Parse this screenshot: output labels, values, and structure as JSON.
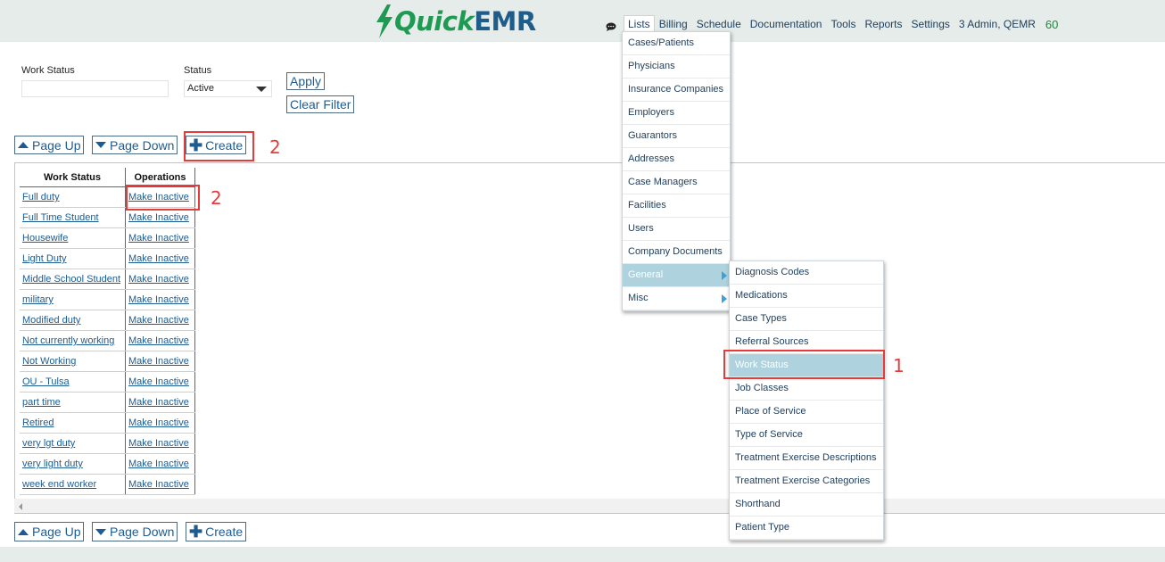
{
  "brand": {
    "part1": "Quick",
    "part2": "EMR"
  },
  "nav": {
    "chat_icon": "speech-bubble-icon",
    "items": [
      "Lists",
      "Billing",
      "Schedule",
      "Documentation",
      "Tools",
      "Reports",
      "Settings",
      "3 Admin, QEMR"
    ],
    "count": "60"
  },
  "filters": {
    "work_status_label": "Work Status",
    "work_status_value": "",
    "status_label": "Status",
    "status_value": "Active",
    "apply": "Apply",
    "clear": "Clear Filter"
  },
  "pager": {
    "page_up": "Page Up",
    "page_down": "Page Down",
    "create": "Create"
  },
  "annotations": {
    "one": "1",
    "two_create": "2",
    "two_row": "2"
  },
  "table": {
    "headers": [
      "Work Status",
      "Operations"
    ],
    "rows": [
      {
        "status": "Full duty",
        "op": "Make Inactive"
      },
      {
        "status": "Full Time Student",
        "op": "Make Inactive"
      },
      {
        "status": "Housewife",
        "op": "Make Inactive"
      },
      {
        "status": "Light Duty",
        "op": "Make Inactive"
      },
      {
        "status": "Middle School Student",
        "op": "Make Inactive"
      },
      {
        "status": "military",
        "op": "Make Inactive"
      },
      {
        "status": "Modified duty",
        "op": "Make Inactive"
      },
      {
        "status": "Not currently working",
        "op": "Make Inactive"
      },
      {
        "status": "Not Working",
        "op": "Make Inactive"
      },
      {
        "status": "OU - Tulsa",
        "op": "Make Inactive"
      },
      {
        "status": "part time",
        "op": "Make Inactive"
      },
      {
        "status": "Retired",
        "op": "Make Inactive"
      },
      {
        "status": "very lgt duty",
        "op": "Make Inactive"
      },
      {
        "status": "very light duty",
        "op": "Make Inactive"
      },
      {
        "status": "week end worker",
        "op": "Make Inactive"
      }
    ]
  },
  "lists_menu": [
    "Cases/Patients",
    "Physicians",
    "Insurance Companies",
    "Employers",
    "Guarantors",
    "Addresses",
    "Case Managers",
    "Facilities",
    "Users",
    "Company Documents",
    "General",
    "Misc"
  ],
  "general_menu": [
    "Diagnosis Codes",
    "Medications",
    "Case Types",
    "Referral Sources",
    "Work Status",
    "Job Classes",
    "Place of Service",
    "Type of Service",
    "Treatment Exercise Descriptions",
    "Treatment Exercise Categories",
    "Shorthand",
    "Patient Type"
  ],
  "colors": {
    "accent": "#1c5c92",
    "highlight": "#aed3df",
    "annotation": "#e63b3b",
    "brand_green": "#1f9a52"
  }
}
